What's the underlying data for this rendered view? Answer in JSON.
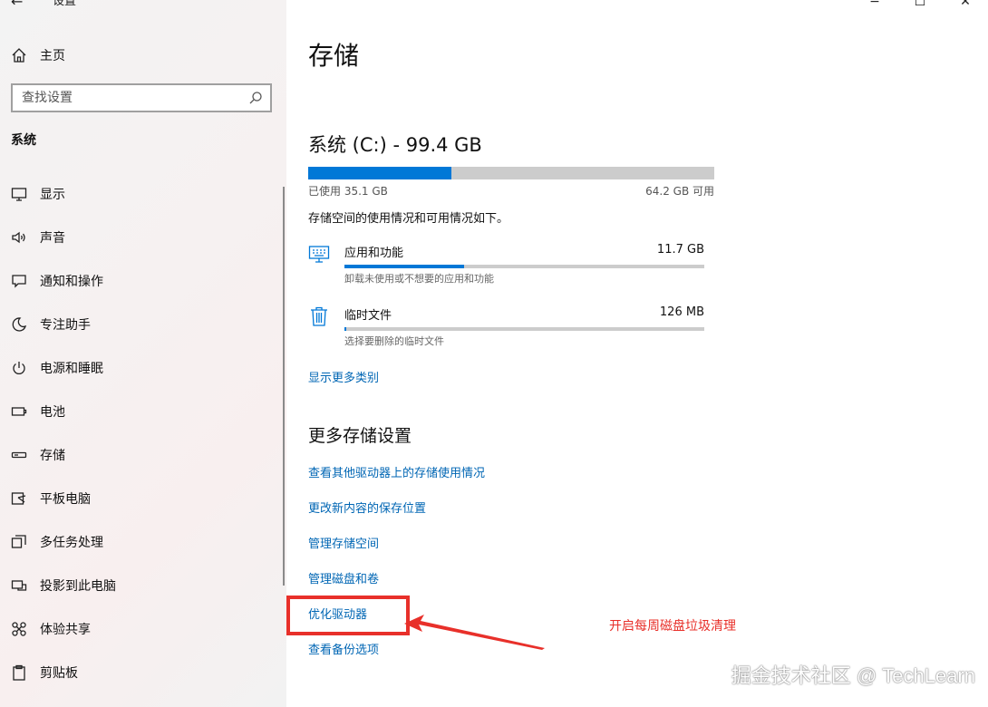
{
  "app": {
    "title": "设置"
  },
  "window_controls": {
    "minimize": "−",
    "maximize": "☐",
    "close": "✕"
  },
  "sidebar": {
    "home_label": "主页",
    "search_placeholder": "查找设置",
    "section_label": "系统",
    "items": [
      {
        "label": "显示",
        "icon": "monitor-icon"
      },
      {
        "label": "声音",
        "icon": "speaker-icon"
      },
      {
        "label": "通知和操作",
        "icon": "notification-icon"
      },
      {
        "label": "专注助手",
        "icon": "moon-icon"
      },
      {
        "label": "电源和睡眠",
        "icon": "power-icon"
      },
      {
        "label": "电池",
        "icon": "battery-icon"
      },
      {
        "label": "存储",
        "icon": "storage-icon"
      },
      {
        "label": "平板电脑",
        "icon": "tablet-icon"
      },
      {
        "label": "多任务处理",
        "icon": "multitask-icon"
      },
      {
        "label": "投影到此电脑",
        "icon": "project-icon"
      },
      {
        "label": "体验共享",
        "icon": "share-icon"
      },
      {
        "label": "剪贴板",
        "icon": "clipboard-icon"
      }
    ]
  },
  "main": {
    "page_title": "存储",
    "drive": {
      "title": "系统 (C:) - 99.4 GB",
      "used_label": "已使用 35.1 GB",
      "free_label": "64.2 GB 可用",
      "used_fraction": 0.353,
      "description": "存储空间的使用情况和可用情况如下。"
    },
    "categories": [
      {
        "name": "应用和功能",
        "size": "11.7 GB",
        "subtitle": "卸载未使用或不想要的应用和功能",
        "fraction": 0.333,
        "icon": "apps-icon"
      },
      {
        "name": "临时文件",
        "size": "126 MB",
        "subtitle": "选择要删除的临时文件",
        "fraction": 0.004,
        "icon": "trash-icon"
      }
    ],
    "show_more_link": "显示更多类别",
    "more_settings_title": "更多存储设置",
    "more_links": [
      "查看其他驱动器上的存储使用情况",
      "更改新内容的保存位置",
      "管理存储空间",
      "管理磁盘和卷",
      "优化驱动器",
      "查看备份选项"
    ]
  },
  "annotation": {
    "text": "开启每周磁盘垃圾清理",
    "color": "#e8302a"
  },
  "watermark": "掘金技术社区 @ TechLearn",
  "colors": {
    "accent": "#0078d7",
    "link": "#0066b4",
    "bar_track": "#cccccc"
  }
}
